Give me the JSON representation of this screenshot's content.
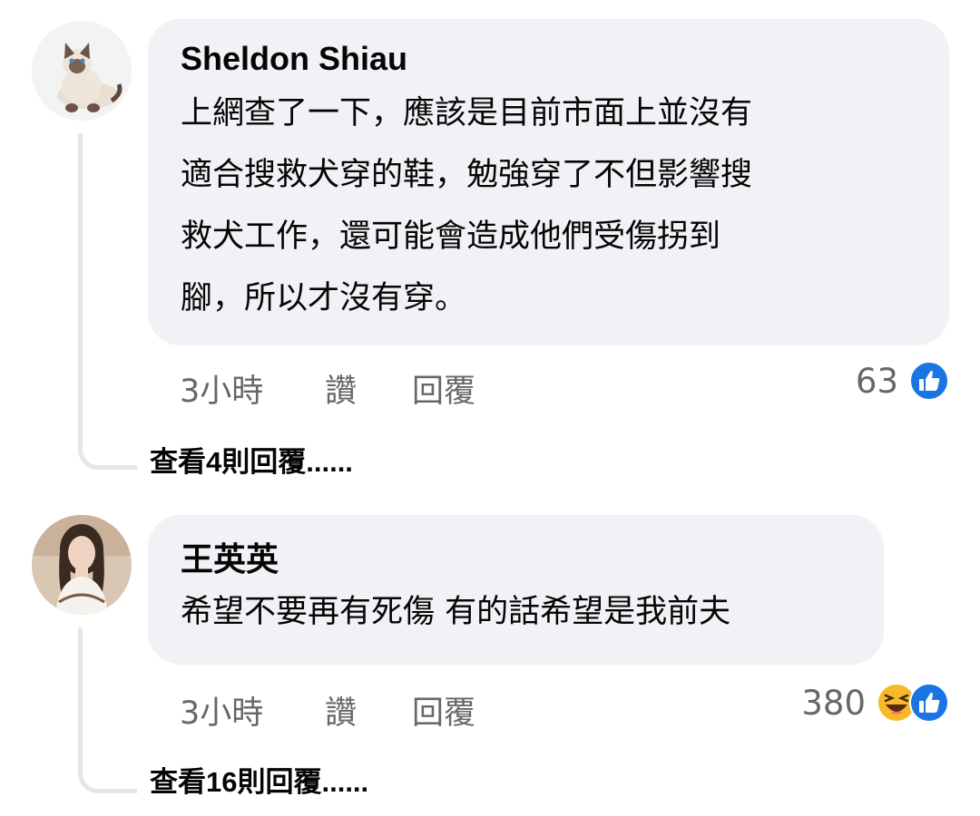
{
  "comments": [
    {
      "author": "Sheldon Shiau",
      "text_lines": [
        "上網查了一下，應該是目前市面上並沒有",
        "適合搜救犬穿的鞋，勉強穿了不但影響搜",
        "救犬工作，還可能會造成他們受傷拐到",
        "腳，所以才沒有穿。"
      ],
      "time": "3小時",
      "like_label": "讚",
      "reply_label": "回覆",
      "reaction_count": "63",
      "reaction_icons": [
        "like-icon"
      ],
      "view_replies": "查看4則回覆......"
    },
    {
      "author": "王英英",
      "text_lines": [
        "希望不要再有死傷 有的話希望是我前夫"
      ],
      "time": "3小時",
      "like_label": "讚",
      "reply_label": "回覆",
      "reaction_count": "380",
      "reaction_icons": [
        "haha-icon",
        "like-icon"
      ],
      "view_replies": "查看16則回覆......"
    }
  ],
  "colors": {
    "bubble_bg": "#f0f2f5",
    "text": "#050505",
    "secondary_text": "#65676b",
    "like_blue": "#1b74e4",
    "haha_yellow": "#f7b928"
  }
}
